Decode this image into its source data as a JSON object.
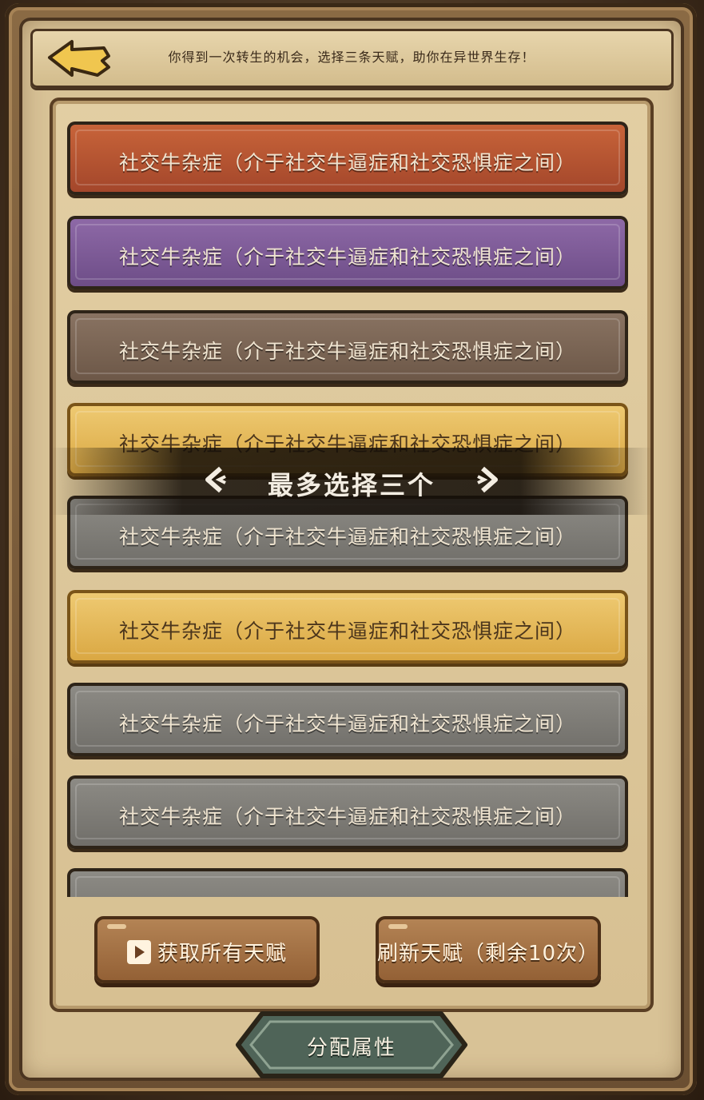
{
  "header": {
    "prompt": "你得到一次转生的机会，选择三条天赋，助你在异世界生存！",
    "back_icon": "back-arrow-icon"
  },
  "talents": [
    {
      "label": "社交牛杂症（介于社交牛逼症和社交恐惧症之间）",
      "rarity_color": "#b5532f"
    },
    {
      "label": "社交牛杂症（介于社交牛逼症和社交恐惧症之间）",
      "rarity_color": "#7d5b98"
    },
    {
      "label": "社交牛杂症（介于社交牛逼症和社交恐惧症之间）",
      "rarity_color": "#7a6554"
    },
    {
      "label": "社交牛杂症（介于社交牛逼症和社交恐惧症之间）",
      "rarity_color": "#e2b454"
    },
    {
      "label": "社交牛杂症（介于社交牛逼症和社交恐惧症之间）",
      "rarity_color": "#7e7c77"
    },
    {
      "label": "社交牛杂症（介于社交牛逼症和社交恐惧症之间）",
      "rarity_color": "#e2b454"
    },
    {
      "label": "社交牛杂症（介于社交牛逼症和社交恐惧症之间）",
      "rarity_color": "#7e7c77"
    },
    {
      "label": "社交牛杂症（介于社交牛逼症和社交恐惧症之间）",
      "rarity_color": "#7e7c77"
    },
    {
      "label": "",
      "rarity_color": "#7e7c77"
    }
  ],
  "toast": {
    "message": "最多选择三个"
  },
  "buttons": {
    "get_all": "获取所有天赋",
    "refresh": "刷新天赋（剩余10次）",
    "allocate": "分配属性"
  }
}
